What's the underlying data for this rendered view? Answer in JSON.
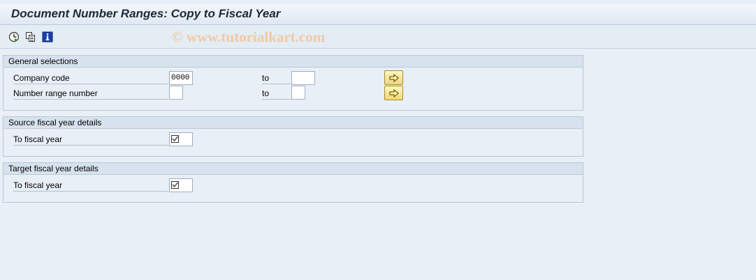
{
  "window": {
    "title": "Document Number Ranges: Copy to Fiscal Year"
  },
  "toolbar": {
    "buttons": [
      {
        "icon": "execute-icon"
      },
      {
        "icon": "multiple-selection-icon"
      },
      {
        "icon": "information-icon"
      }
    ],
    "watermark": "© www.tutorialkart.com"
  },
  "groups": {
    "general": {
      "title": "General selections",
      "rows": [
        {
          "label": "Company code",
          "from_value": "0000",
          "to_label": "to",
          "to_value": ""
        },
        {
          "label": "Number range number",
          "from_value": "",
          "to_label": "to",
          "to_value": ""
        }
      ]
    },
    "source": {
      "title": "Source fiscal year details",
      "field_label": "To fiscal year",
      "field_value": ""
    },
    "target": {
      "title": "Target fiscal year details",
      "field_label": "To fiscal year",
      "field_value": ""
    }
  },
  "colors": {
    "background": "#e8eff6",
    "group_header": "#d7e2ee",
    "multiple_selection_button": "#f0d870",
    "watermark": "#f2c9a3"
  }
}
